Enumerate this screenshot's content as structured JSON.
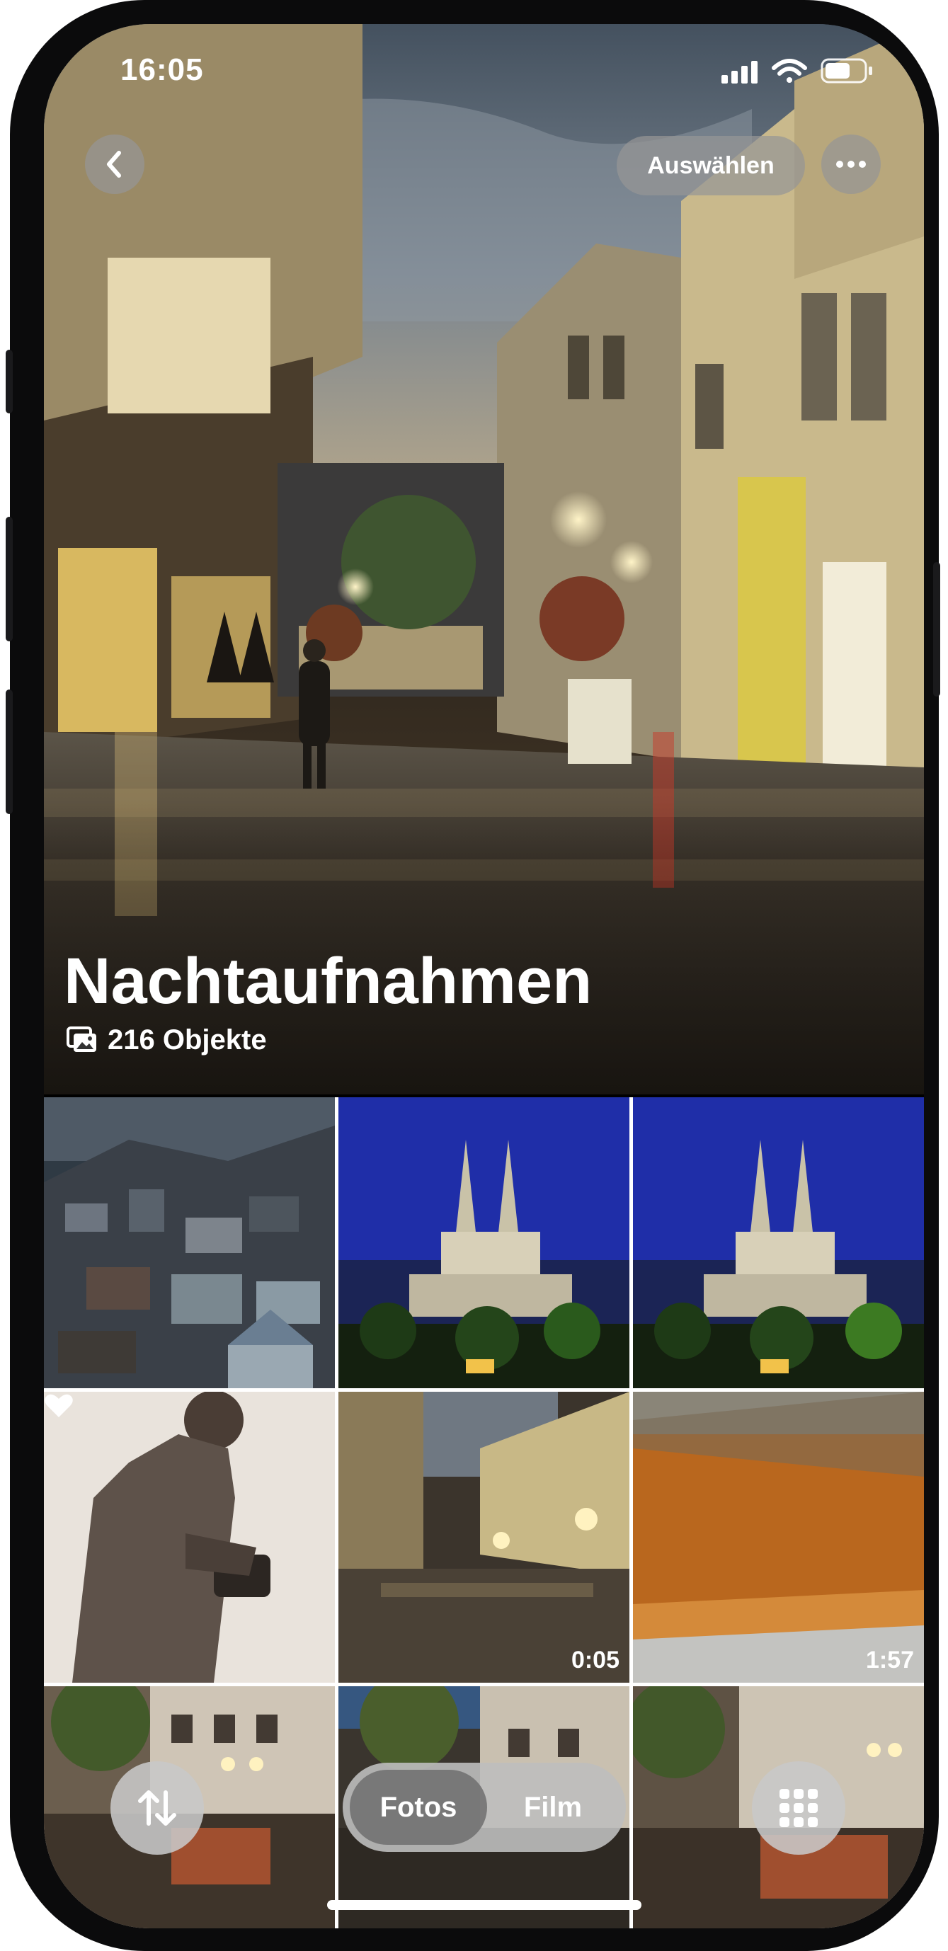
{
  "status_bar": {
    "time": "16:05",
    "icons": [
      "cellular-signal-icon",
      "wifi-icon",
      "battery-icon"
    ]
  },
  "nav": {
    "back_icon": "chevron-left-icon",
    "select_label": "Auswählen",
    "more_icon": "ellipsis-icon"
  },
  "album": {
    "title": "Nachtaufnahmen",
    "count_icon": "photo-stack-icon",
    "count_label": "216 Objekte"
  },
  "grid": {
    "tiles": [
      {
        "subject": "hillside-city-at-dusk"
      },
      {
        "subject": "cathedral-at-night"
      },
      {
        "subject": "cathedral-at-night"
      },
      {
        "subject": "photographer-silhouette",
        "favorite": true
      },
      {
        "subject": "rainy-street-at-night",
        "duration": "0:05"
      },
      {
        "subject": "blurred-orange-pavement",
        "duration": "1:57"
      },
      {
        "subject": "street-cafe-at-night"
      },
      {
        "subject": "street-cafe-at-night"
      },
      {
        "subject": "street-cafe-at-night"
      }
    ]
  },
  "bottom_bar": {
    "sort_icon": "sort-arrows-icon",
    "segment_photos": "Fotos",
    "segment_film": "Film",
    "selected_segment": "Fotos",
    "grid_icon": "grid-icon"
  }
}
